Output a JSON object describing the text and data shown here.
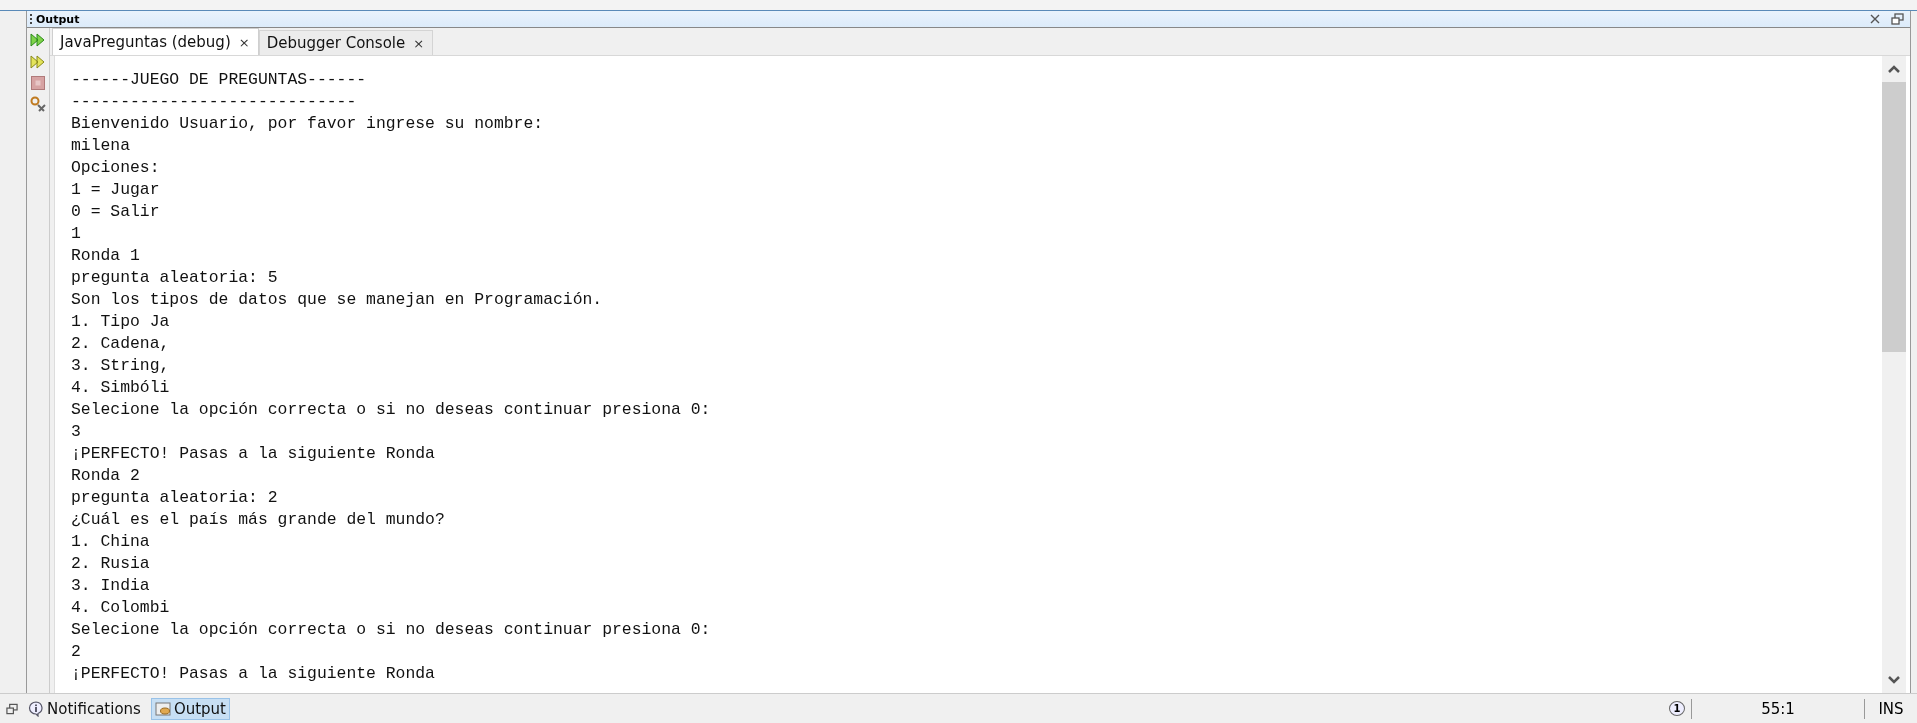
{
  "window": {
    "title": "Output"
  },
  "tabs": [
    {
      "label": "JavaPreguntas (debug)",
      "selected": true,
      "close": "×"
    },
    {
      "label": "Debugger Console",
      "selected": false,
      "close": "×"
    }
  ],
  "console_lines": [
    "------JUEGO DE PREGUNTAS------",
    "-----------------------------",
    "Bienvenido Usuario, por favor ingrese su nombre:",
    "milena",
    "Opciones:",
    "1 = Jugar",
    "0 = Salir",
    "1",
    "Ronda 1",
    "pregunta aleatoria: 5",
    "Son los tipos de datos que se manejan en Programación.",
    "1. Tipo Ja",
    "2. Cadena,",
    "3. String,",
    "4. Simbóli",
    "Selecione la opción correcta o si no deseas continuar presiona 0:",
    "3",
    "¡PERFECTO! Pasas a la siguiente Ronda",
    "Ronda 2",
    "pregunta aleatoria: 2",
    "¿Cuál es el país más grande del mundo?",
    "1. China",
    "2. Rusia",
    "3. India",
    "4. Colombi",
    "Selecione la opción correcta o si no deseas continuar presiona 0:",
    "2",
    "¡PERFECTO! Pasas a la siguiente Ronda"
  ],
  "status_bar": {
    "windows": [
      {
        "label": "Notifications",
        "kind": "notifications",
        "selected": false
      },
      {
        "label": "Output",
        "kind": "output",
        "selected": true
      }
    ],
    "notification_count": "1",
    "position": "55:1",
    "mode": "INS"
  }
}
